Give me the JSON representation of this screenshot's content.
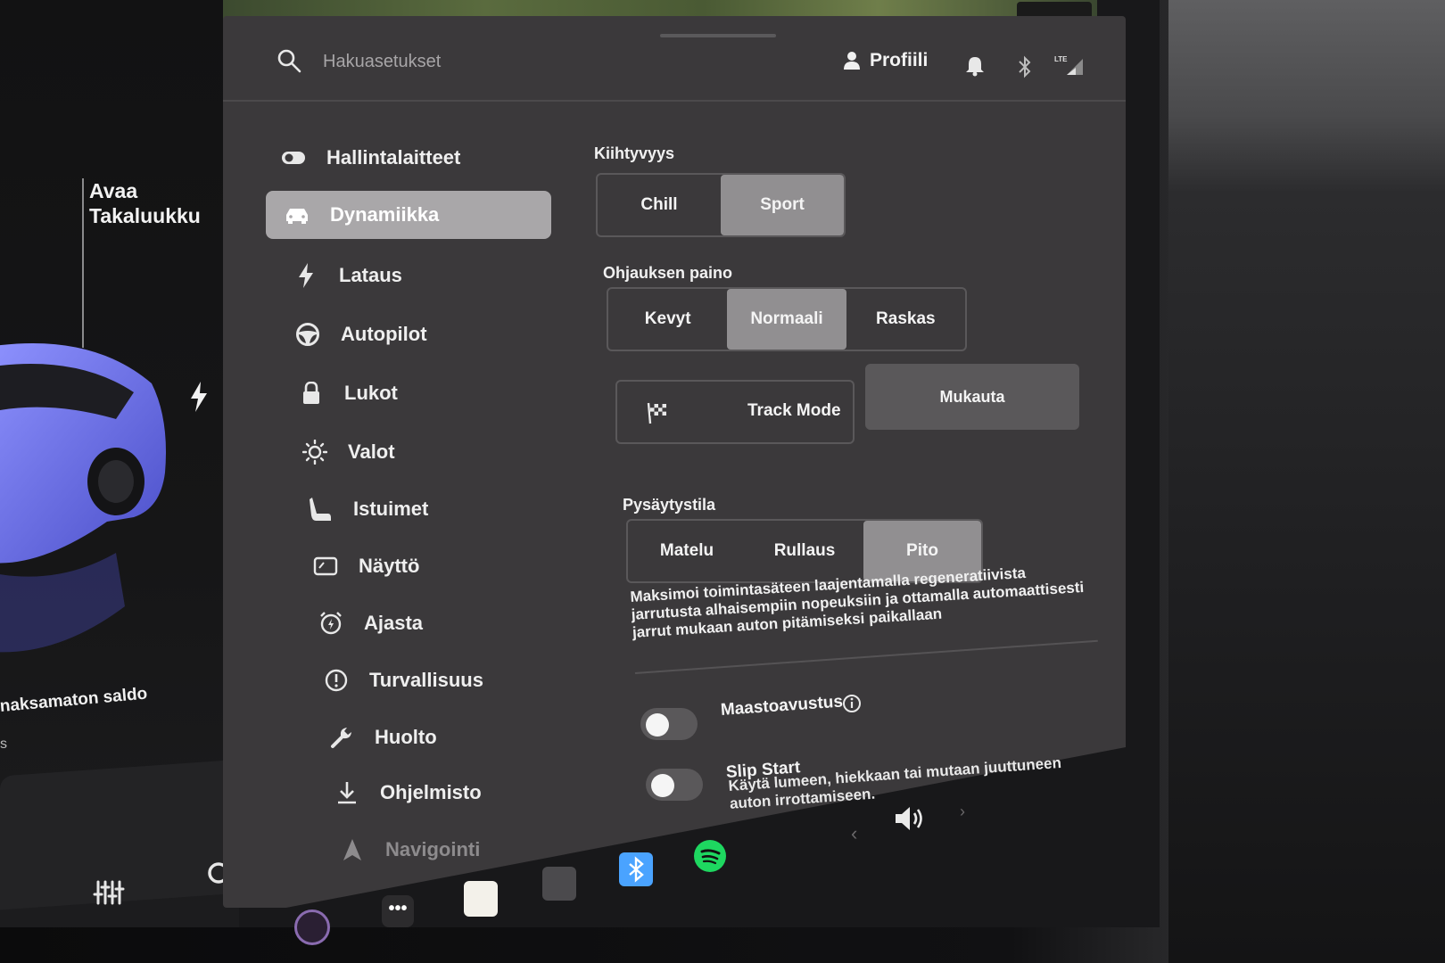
{
  "search": {
    "placeholder": "Hakuasetukset"
  },
  "header": {
    "profile_label": "Profiili"
  },
  "car_panel": {
    "trunk_line1": "Avaa",
    "trunk_line2": "Takaluukku",
    "balance_label": "naksamaton saldo",
    "balance_sub": "s"
  },
  "nav": {
    "items": [
      {
        "label": "Hallintalaitteet",
        "icon": "toggle-icon"
      },
      {
        "label": "Dynamiikka",
        "icon": "car-icon",
        "active": true
      },
      {
        "label": "Lataus",
        "icon": "lightning-icon"
      },
      {
        "label": "Autopilot",
        "icon": "steering-wheel-icon"
      },
      {
        "label": "Lukot",
        "icon": "lock-icon"
      },
      {
        "label": "Valot",
        "icon": "sun-icon"
      },
      {
        "label": "Istuimet",
        "icon": "seat-icon"
      },
      {
        "label": "Näyttö",
        "icon": "display-icon"
      },
      {
        "label": "Ajasta",
        "icon": "alarm-clock-icon"
      },
      {
        "label": "Turvallisuus",
        "icon": "alert-circle-icon"
      },
      {
        "label": "Huolto",
        "icon": "wrench-icon"
      },
      {
        "label": "Ohjelmisto",
        "icon": "download-icon"
      },
      {
        "label": "Navigointi",
        "icon": "navigation-arrow-icon"
      }
    ]
  },
  "acceleration": {
    "title": "Kiihtyvyys",
    "options": [
      "Chill",
      "Sport"
    ],
    "selected": "Sport"
  },
  "steering": {
    "title": "Ohjauksen paino",
    "options": [
      "Kevyt",
      "Normaali",
      "Raskas"
    ],
    "selected": "Normaali"
  },
  "track_mode": {
    "label": "Track Mode",
    "customize_label": "Mukauta"
  },
  "stopping": {
    "title": "Pysäytystila",
    "options": [
      "Matelu",
      "Rullaus",
      "Pito"
    ],
    "selected": "Pito",
    "description": "Maksimoi toimintasäteen laajentamalla regeneratiivista jarrutusta alhaisempiin nopeuksiin ja ottamalla automaattisesti jarrut mukaan auton pitämiseksi paikallaan"
  },
  "terrain_assist": {
    "label": "Maastoavustus",
    "enabled": false
  },
  "slip_start": {
    "label": "Slip Start",
    "description": "Käytä lumeen, hiekkaan tai mutaan juuttuneen auton irrottamiseen.",
    "enabled": false
  },
  "colors": {
    "panel_bg": "#3b393b",
    "selected_option": "#918f91",
    "active_nav": "#a9a7a9",
    "spotify": "#1ed760",
    "bluetooth_app": "#4aa3ff"
  }
}
